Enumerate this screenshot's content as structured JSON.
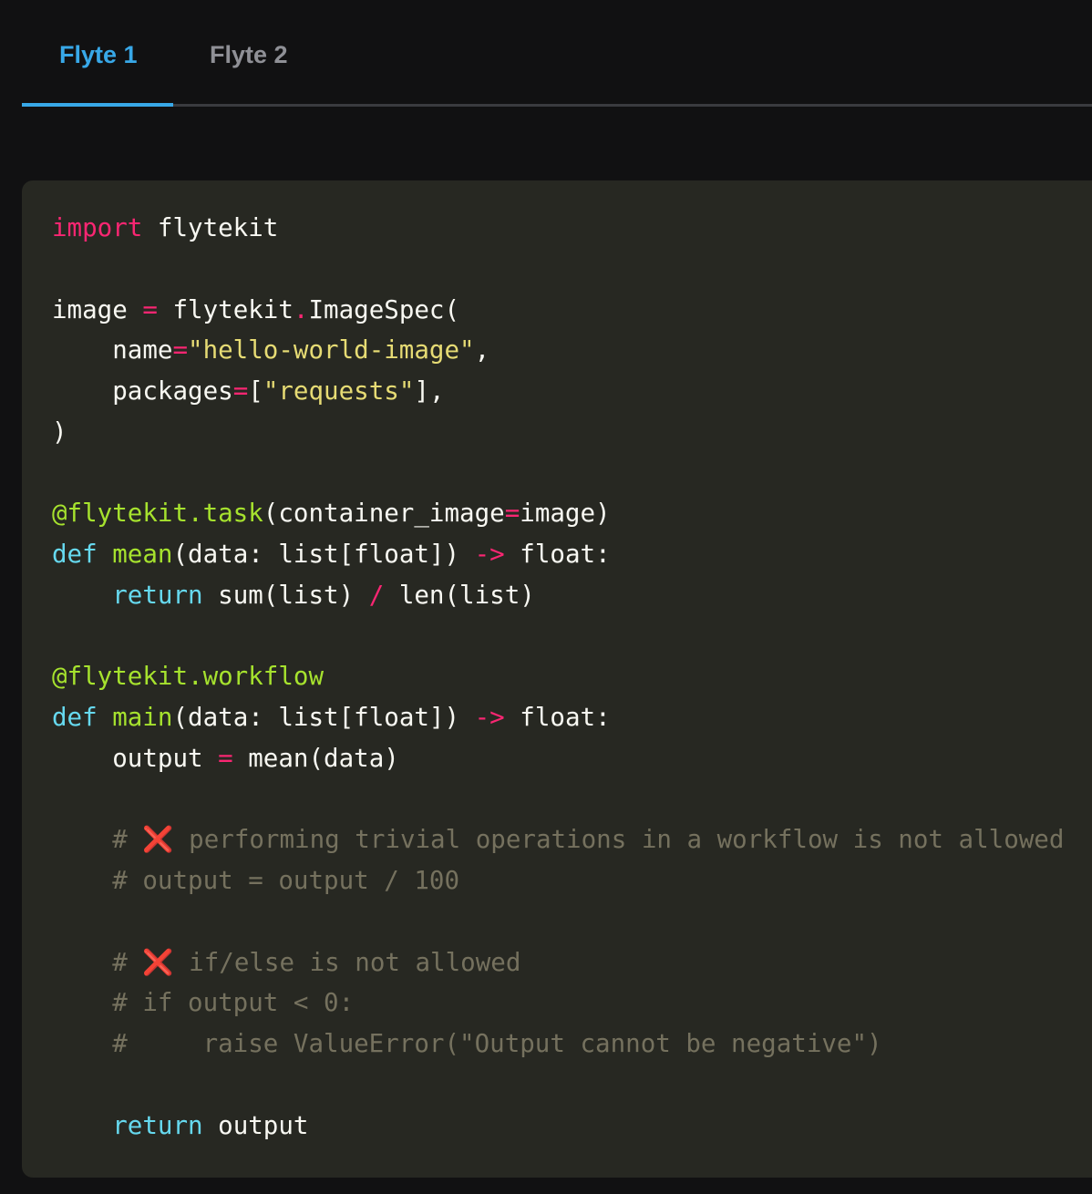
{
  "tabs": [
    {
      "label": "Flyte 1",
      "active": true
    },
    {
      "label": "Flyte 2",
      "active": false
    }
  ],
  "colors": {
    "active_tab": "#38a8e8",
    "inactive_tab": "#8f9096",
    "background": "#111112",
    "code_background": "#272822"
  },
  "code": {
    "language": "python",
    "l1_kw": "import",
    "l1_rest": " flytekit",
    "l3_a": "image ",
    "l3_eq": "=",
    "l3_b": " flytekit",
    "l3_dot": ".",
    "l3_c": "ImageSpec(",
    "l4_a": "    name",
    "l4_eq": "=",
    "l4_str": "\"hello-world-image\"",
    "l4_b": ",",
    "l5_a": "    packages",
    "l5_eq": "=",
    "l5_b": "[",
    "l5_str": "\"requests\"",
    "l5_c": "],",
    "l6": ")",
    "l8_dec": "@flytekit.task",
    "l8_a": "(container_image",
    "l8_eq": "=",
    "l8_b": "image)",
    "l9_kw": "def",
    "l9_sp": " ",
    "l9_fn": "mean",
    "l9_a": "(data: list[float]) ",
    "l9_arrow": "->",
    "l9_b": " float:",
    "l10_kw": "    return",
    "l10_a": " sum(list) ",
    "l10_op": "/",
    "l10_b": " len(list)",
    "l12_dec": "@flytekit.workflow",
    "l13_kw": "def",
    "l13_sp": " ",
    "l13_fn": "main",
    "l13_a": "(data: list[float]) ",
    "l13_arrow": "->",
    "l13_b": " float:",
    "l14_a": "    output ",
    "l14_eq": "=",
    "l14_b": " mean(data)",
    "l16_hash": "    # ",
    "l16_cross": "❌",
    "l16_text": " performing trivial operations in a workflow is not allowed",
    "l17": "    # output = output / 100",
    "l19_hash": "    # ",
    "l19_cross": "❌",
    "l19_text": " if/else is not allowed",
    "l20": "    # if output < 0:",
    "l21": "    #     raise ValueError(\"Output cannot be negative\")",
    "l23_kw": "    return",
    "l23_rest": " output"
  }
}
